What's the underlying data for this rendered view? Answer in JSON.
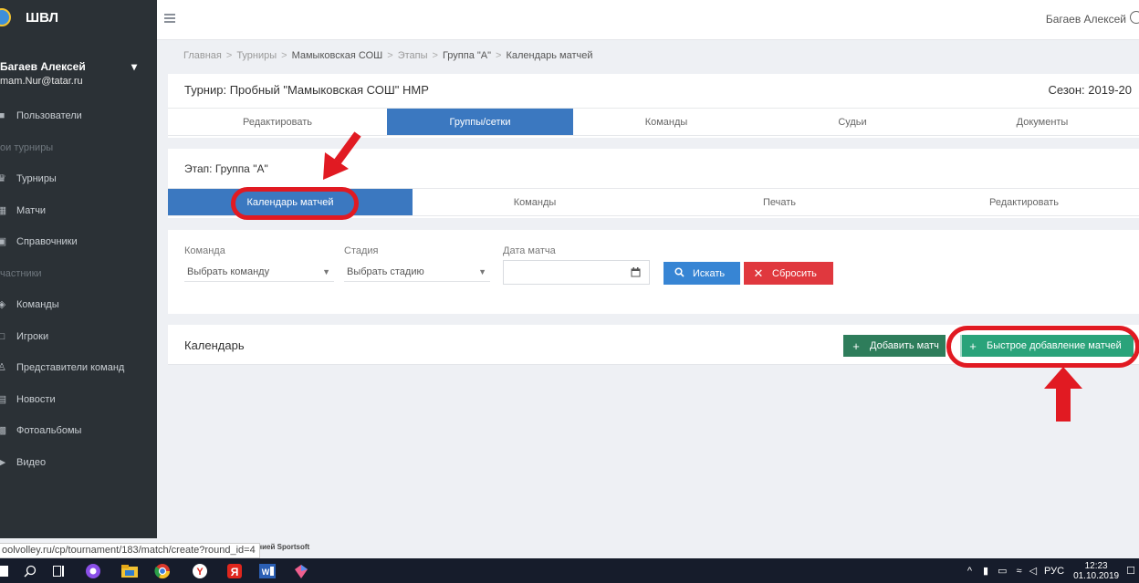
{
  "sidebar": {
    "brand": "ШВЛ",
    "user_name": "Багаев Алексей",
    "user_caret": "▾",
    "user_email": "mam.Nur@tatar.ru",
    "items": [
      {
        "kind": "item",
        "icon": "users-icon",
        "label": "Пользователи"
      },
      {
        "kind": "section",
        "label": "ои турниры"
      },
      {
        "kind": "item",
        "icon": "trophy-icon",
        "label": "Турниры"
      },
      {
        "kind": "item",
        "icon": "calendar-icon",
        "label": "Матчи"
      },
      {
        "kind": "item",
        "icon": "book-icon",
        "label": "Справочники"
      },
      {
        "kind": "section",
        "label": "частники"
      },
      {
        "kind": "item",
        "icon": "shield-icon",
        "label": "Команды"
      },
      {
        "kind": "item",
        "icon": "player-icon",
        "label": "Игроки"
      },
      {
        "kind": "item",
        "icon": "user-icon",
        "label": "Представители команд"
      },
      {
        "kind": "item",
        "icon": "news-icon",
        "label": "Новости"
      },
      {
        "kind": "item",
        "icon": "photo-icon",
        "label": "Фотоальбомы"
      },
      {
        "kind": "item",
        "icon": "video-icon",
        "label": "Видео"
      }
    ]
  },
  "topbar": {
    "user_name": "Багаев Алексей"
  },
  "breadcrumb": {
    "items": [
      "Главная",
      "Турниры",
      "Мамыковская СОШ",
      "Этапы",
      "Группа \"А\"",
      "Календарь матчей"
    ],
    "sep": ">"
  },
  "tournament": {
    "title": "Турнир: Пробный \"Мамыковская СОШ\" НМР",
    "season": "Сезон: 2019-20",
    "tabs": [
      "Редактировать",
      "Группы/сетки",
      "Команды",
      "Судьи",
      "Документы"
    ]
  },
  "stage": {
    "title": "Этап: Группа \"А\"",
    "tabs": [
      "Календарь матчей",
      "Команды",
      "Печать",
      "Редактировать"
    ]
  },
  "filter": {
    "team_label": "Команда",
    "team_value": "Выбрать команду",
    "stage_label": "Стадия",
    "stage_value": "Выбрать стадию",
    "date_label": "Дата матча",
    "date_value": "",
    "search_label": "Искать",
    "reset_label": "Сбросить"
  },
  "calendar": {
    "title": "Календарь",
    "add_match_label": "Добавить матч",
    "quick_add_label": "Быстрое добавление матчей"
  },
  "status": {
    "url": "oolvolley.ru/cp/tournament/183/match/create?round_id=4",
    "footer": "панией Sportsoft"
  },
  "taskbar": {
    "lang": "РУС",
    "time": "12:23",
    "date": "01.10.2019"
  },
  "colors": {
    "sidebar": "#2b3136",
    "active_tab": "#3b78c0",
    "search": "#3785d4",
    "reset": "#e0383e",
    "add_match": "#2e7d5b",
    "quick_add": "#2aa37a",
    "annotation": "#e11a22"
  }
}
